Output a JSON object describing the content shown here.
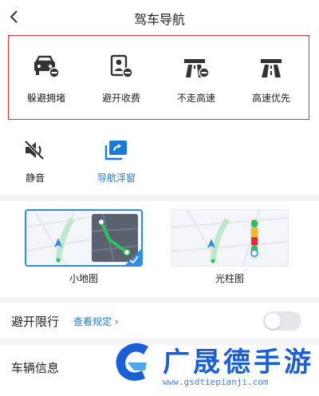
{
  "header": {
    "title": "驾车导航",
    "back_icon": "chevron-left-icon"
  },
  "route_preferences": [
    {
      "label": "躲避拥堵",
      "icon": "car-avoid-congestion-icon"
    },
    {
      "label": "避开收费",
      "icon": "toll-avoid-icon"
    },
    {
      "label": "不走高速",
      "icon": "no-highway-icon"
    },
    {
      "label": "高速优先",
      "icon": "highway-first-icon"
    }
  ],
  "toggles": [
    {
      "label": "静音",
      "icon": "mute-icon",
      "active": false
    },
    {
      "label": "导航浮窗",
      "icon": "floating-window-icon",
      "active": true
    }
  ],
  "map_modes": [
    {
      "label": "小地图",
      "selected": true
    },
    {
      "label": "光柱图",
      "selected": false
    }
  ],
  "restriction": {
    "title": "避开限行",
    "link": "查看规定",
    "enabled": false
  },
  "vehicle": {
    "title": "车辆信息"
  },
  "watermark": {
    "title": "广晟德手游",
    "url": "www.gsdtiepianji.com"
  },
  "colors": {
    "accent": "#1a7bd6",
    "highlight_border": "#e0313a",
    "route_green": "#2fbf5c"
  }
}
